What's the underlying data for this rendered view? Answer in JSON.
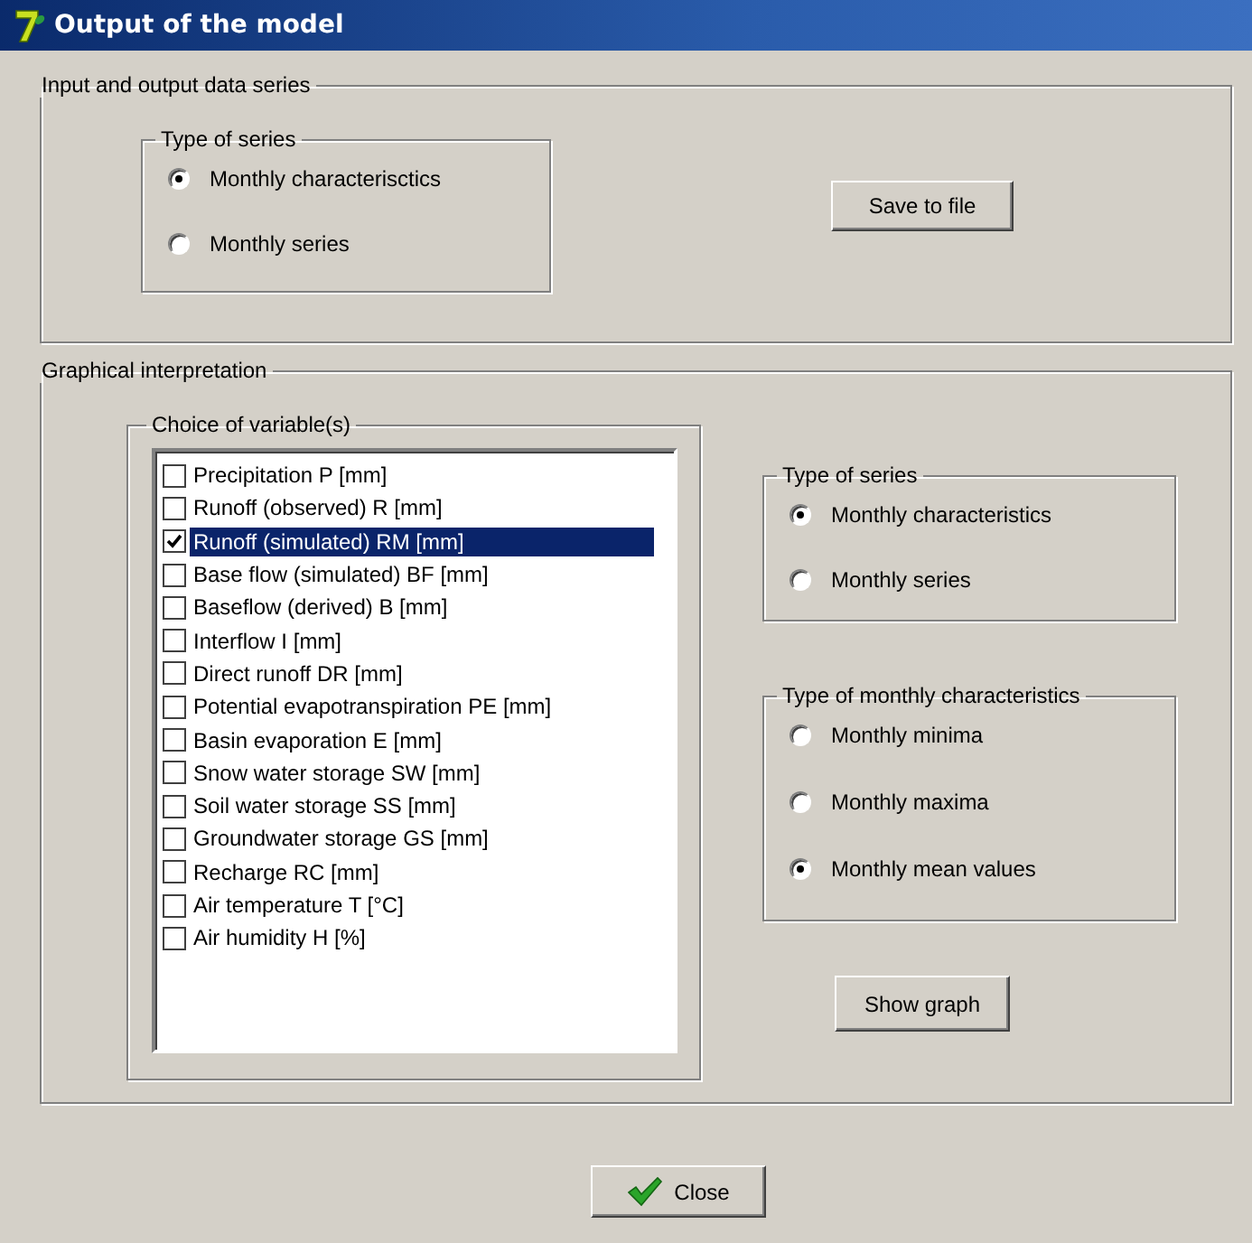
{
  "window": {
    "title": "Output of the model"
  },
  "data_series": {
    "title": "Input and output data series",
    "type_of_series": {
      "title": "Type of series",
      "options": [
        {
          "label": "Monthly characterisctics",
          "selected": true
        },
        {
          "label": "Monthly series",
          "selected": false
        }
      ]
    },
    "save_button": "Save to file"
  },
  "graphical": {
    "title": "Graphical interpretation",
    "variables": {
      "title": "Choice of variable(s)",
      "items": [
        {
          "label": "Precipitation P [mm]",
          "checked": false,
          "selected": false
        },
        {
          "label": "Runoff (observed) R [mm]",
          "checked": false,
          "selected": false
        },
        {
          "label": "Runoff (simulated) RM [mm]",
          "checked": true,
          "selected": true
        },
        {
          "label": "Base flow (simulated) BF [mm]",
          "checked": false,
          "selected": false
        },
        {
          "label": "Baseflow (derived) B [mm]",
          "checked": false,
          "selected": false
        },
        {
          "label": "Interflow I [mm]",
          "checked": false,
          "selected": false
        },
        {
          "label": "Direct runoff DR [mm]",
          "checked": false,
          "selected": false
        },
        {
          "label": "Potential evapotranspiration PE [mm]",
          "checked": false,
          "selected": false
        },
        {
          "label": "Basin evaporation E [mm]",
          "checked": false,
          "selected": false
        },
        {
          "label": "Snow water storage SW [mm]",
          "checked": false,
          "selected": false
        },
        {
          "label": "Soil water storage SS [mm]",
          "checked": false,
          "selected": false
        },
        {
          "label": "Groundwater storage GS [mm]",
          "checked": false,
          "selected": false
        },
        {
          "label": "Recharge RC [mm]",
          "checked": false,
          "selected": false
        },
        {
          "label": "Air temperature T [°C]",
          "checked": false,
          "selected": false
        },
        {
          "label": "Air humidity H [%]",
          "checked": false,
          "selected": false
        }
      ]
    },
    "type_of_series": {
      "title": "Type of series",
      "options": [
        {
          "label": "Monthly characteristics",
          "selected": true
        },
        {
          "label": "Monthly series",
          "selected": false
        }
      ]
    },
    "monthly_characteristics": {
      "title": "Type of monthly characteristics",
      "options": [
        {
          "label": "Monthly minima",
          "selected": false
        },
        {
          "label": "Monthly maxima",
          "selected": false
        },
        {
          "label": "Monthly mean values",
          "selected": true
        }
      ]
    },
    "show_graph_button": "Show graph"
  },
  "close_button": "Close"
}
